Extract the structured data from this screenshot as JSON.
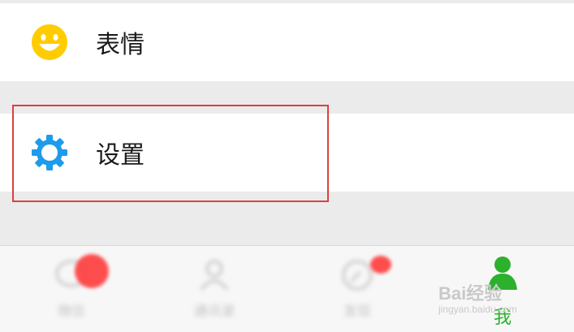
{
  "list": {
    "emoji_row": {
      "label": "表情",
      "icon": "smiley-icon",
      "icon_color": "#ffcc00"
    },
    "settings_row": {
      "label": "设置",
      "icon": "gear-icon",
      "icon_color": "#1e9bea"
    }
  },
  "highlight_color": "#d9413f",
  "tabbar": {
    "tabs": [
      {
        "icon": "chat-bubble-icon",
        "label": "微信",
        "badge": true
      },
      {
        "icon": "contacts-icon",
        "label": "通讯录",
        "badge": false
      },
      {
        "icon": "compass-icon",
        "label": "发现",
        "badge": true
      },
      {
        "icon": "person-icon",
        "label": "我",
        "active": true,
        "active_color": "#2bb12b"
      }
    ]
  },
  "watermark": {
    "brand": "Bai经验",
    "url": "jingyan.baidu.com"
  }
}
